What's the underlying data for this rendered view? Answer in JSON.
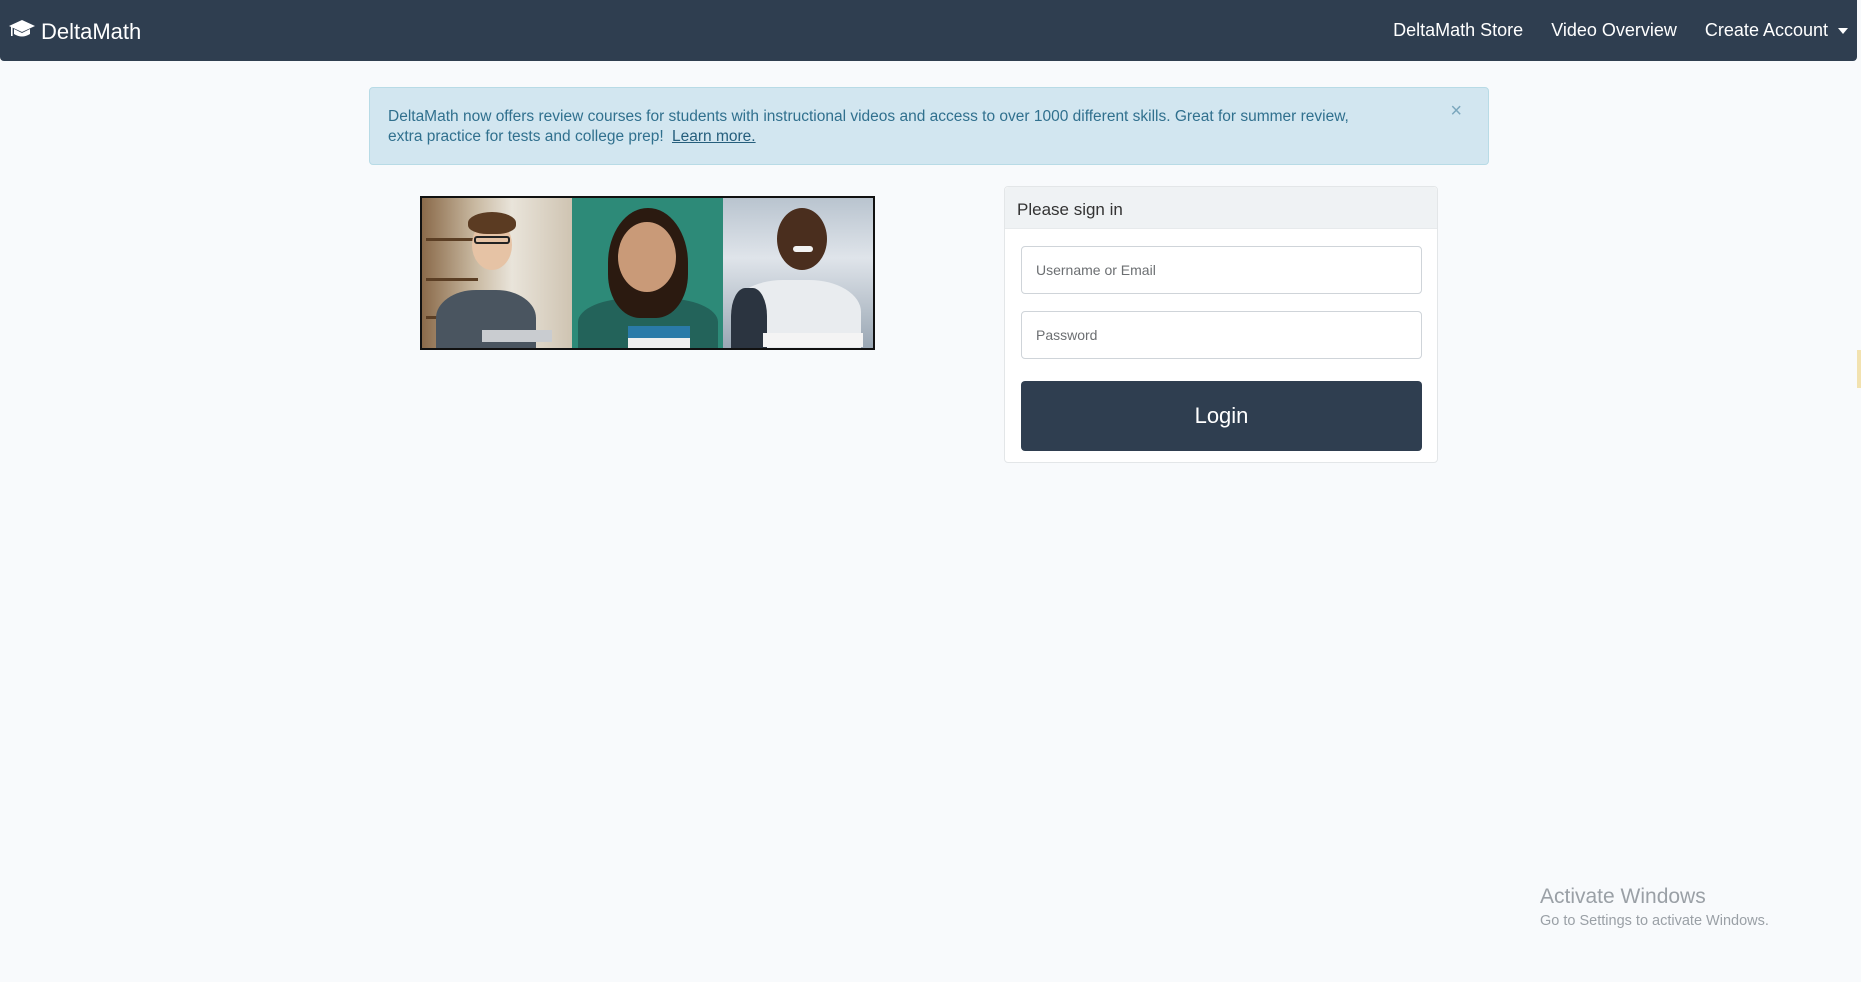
{
  "navbar": {
    "brand": "DeltaMath",
    "links": [
      "DeltaMath Store",
      "Video Overview",
      "Create Account"
    ]
  },
  "alert": {
    "message": "DeltaMath now offers review courses for students with instructional videos and access to over 1000 different skills. Great for summer review, extra practice for tests and college prep!",
    "link_text": "Learn more.",
    "close": "×"
  },
  "signin": {
    "header": "Please sign in",
    "username_placeholder": "Username or Email",
    "password_placeholder": "Password",
    "login_label": "Login"
  },
  "watermark": {
    "line1": "Activate Windows",
    "line2": "Go to Settings to activate Windows."
  },
  "colors": {
    "navbar": "#2f3e50",
    "alert_bg": "#d2e6f0",
    "alert_text": "#30708e",
    "login_button": "#2f3e50"
  },
  "icons": {
    "brand": "graduation-cap-icon",
    "close": "close-icon",
    "dropdown": "caret-down-icon"
  }
}
